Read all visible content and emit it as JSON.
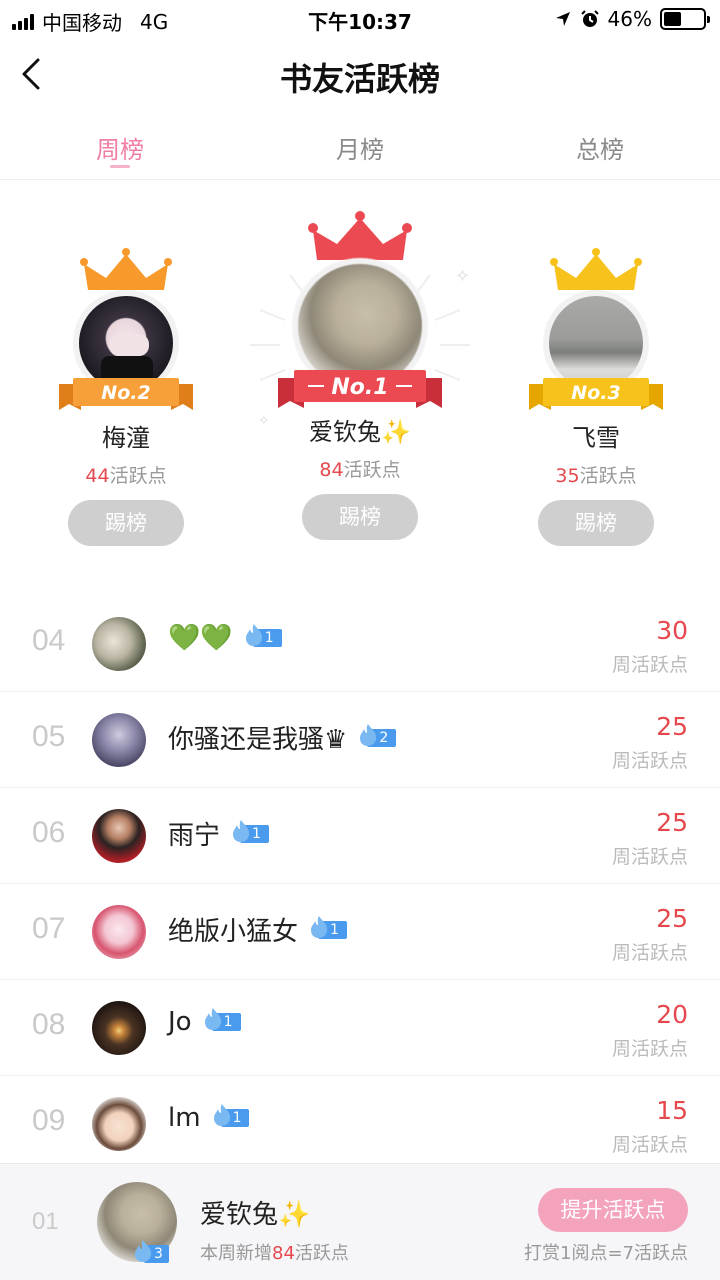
{
  "status": {
    "carrier": "中国移动",
    "network": "4G",
    "time": "下午10:37",
    "battery": "46%",
    "battery_level": 0.46
  },
  "nav": {
    "title": "书友活跃榜"
  },
  "tabs": [
    {
      "label": "周榜"
    },
    {
      "label": "月榜"
    },
    {
      "label": "总榜"
    }
  ],
  "podium": [
    {
      "badge": "No.2",
      "name": "梅潼",
      "points": "44",
      "points_suffix": "活跃点",
      "button": "踢榜"
    },
    {
      "badge": "No.1",
      "name": "爱钦兔✨",
      "points": "84",
      "points_suffix": "活跃点",
      "button": "踢榜"
    },
    {
      "badge": "No.3",
      "name": "飞雪",
      "points": "35",
      "points_suffix": "活跃点",
      "button": "踢榜"
    }
  ],
  "list_label": "周活跃点",
  "list": [
    {
      "rank": "04",
      "name": "💚💚",
      "level": "1",
      "score": "30"
    },
    {
      "rank": "05",
      "name": "你骚还是我骚♛",
      "level": "2",
      "score": "25"
    },
    {
      "rank": "06",
      "name": "雨宁",
      "level": "1",
      "score": "25"
    },
    {
      "rank": "07",
      "name": "绝版小猛女",
      "level": "1",
      "score": "25"
    },
    {
      "rank": "08",
      "name": "Jo",
      "level": "1",
      "score": "20"
    },
    {
      "rank": "09",
      "name": "lm",
      "level": "1",
      "score": "15"
    }
  ],
  "me": {
    "rank": "01",
    "name": "爱钦兔✨",
    "level": "3",
    "sub_prefix": "本周新增",
    "sub_points": "84",
    "sub_suffix": "活跃点",
    "boost_label": "提升活跃点",
    "rule": "打赏1阅点=7活跃点"
  },
  "colors": {
    "accent": "#f07fa3",
    "score": "#e5484d",
    "gold": "#f7a824",
    "silver": "#f79a2b",
    "first": "#ec4a52",
    "third": "#f7c21b",
    "level": "#4a9bee"
  }
}
